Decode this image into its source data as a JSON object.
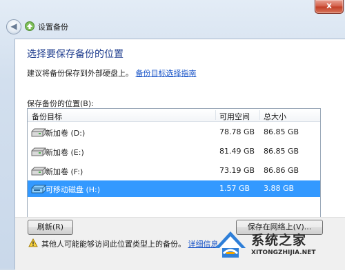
{
  "window": {
    "title": "设置备份",
    "close_glyph": "x",
    "back_glyph": "◀"
  },
  "main": {
    "heading": "选择要保存备份的位置",
    "intro_text": "建议将备份保存到外部硬盘上。",
    "intro_link": "备份目标选择指南",
    "list_label": "保存备份的位置(B):",
    "columns": [
      "备份目标",
      "可用空间",
      "总大小"
    ],
    "rows": [
      {
        "name": "新加卷 (D:)",
        "free": "78.78 GB",
        "total": "86.85 GB",
        "icon": "hard-drive-icon"
      },
      {
        "name": "新加卷 (E:)",
        "free": "81.49 GB",
        "total": "86.85 GB",
        "icon": "hard-drive-icon"
      },
      {
        "name": "新加卷 (F:)",
        "free": "73.19 GB",
        "total": "86.86 GB",
        "icon": "hard-drive-icon"
      },
      {
        "name": "可移动磁盘 (H:)",
        "free": "1.57 GB",
        "total": "3.88 GB",
        "icon": "removable-drive-icon",
        "selected": true
      }
    ]
  },
  "footer": {
    "refresh_label": "刷新(R)",
    "network_label": "保存在网络上(V)...",
    "warning_text": "其他人可能能够访问此位置类型上的备份。",
    "warning_link": "详细信息"
  },
  "watermark": {
    "name": "系统之家",
    "url": "XITONGZHIJIA.NET"
  },
  "colors": {
    "selection": "#3399ff",
    "heading": "#1f3d8e",
    "link": "#1a55c8"
  }
}
